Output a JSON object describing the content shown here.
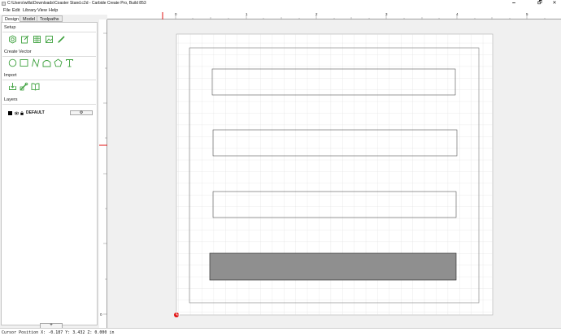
{
  "window": {
    "title": "C:\\Users\\willa\\Downloads\\Coaster Stand.c2d - Carbide Create Pro, Build 853",
    "minimize_glyph": "🗕",
    "maximize_glyph": "🗗",
    "close_glyph": "✕"
  },
  "menu": [
    "File",
    "Edit",
    "Library",
    "View",
    "Help"
  ],
  "tabs": [
    {
      "label": "Design",
      "active": true
    },
    {
      "label": "Model",
      "active": false
    },
    {
      "label": "Toolpaths",
      "active": false
    }
  ],
  "sections": {
    "setup": {
      "title": "Setup",
      "icons": [
        "job-setup-icon",
        "edit-document-icon",
        "grid-icon",
        "image-icon",
        "pencil-icon"
      ]
    },
    "create_vector": {
      "title": "Create Vector",
      "icons": [
        "circle-icon",
        "rectangle-icon",
        "curve-icon",
        "polygon-icon",
        "star-icon",
        "text-icon"
      ]
    },
    "import": {
      "title": "Import",
      "icons": [
        "import-svg-icon",
        "import-bitmap-icon",
        "book-icon"
      ]
    },
    "layers": {
      "title": "Layers",
      "items": [
        {
          "name": "DEFAULT",
          "color": "#000000"
        }
      ],
      "gear_glyph": "⚙",
      "add_label": "+"
    }
  },
  "rulers": {
    "top_labels": [
      "0",
      "1",
      "2",
      "3",
      "4",
      "5"
    ],
    "left_labels": [
      "0"
    ]
  },
  "colors": {
    "icon_green": "#3ca03c",
    "selected_fill": "#8f8f8f",
    "origin_red": "#e01010"
  },
  "status": {
    "cursor_position": "Cursor Position X: -0.187 Y: 3.432 Z: 0.000 in"
  }
}
